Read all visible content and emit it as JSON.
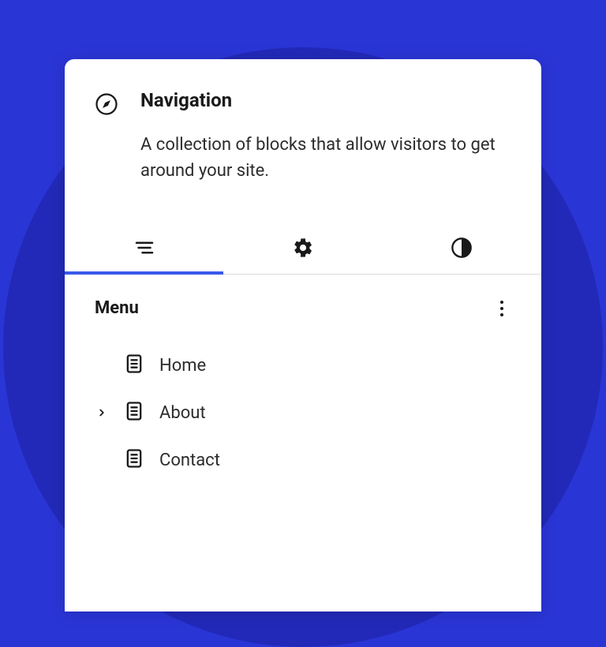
{
  "header": {
    "title": "Navigation",
    "description": "A collection of blocks that allow visitors to get around your site."
  },
  "tabs": {
    "active_index": 0
  },
  "menu": {
    "title": "Menu",
    "items": [
      {
        "label": "Home",
        "has_children": false
      },
      {
        "label": "About",
        "has_children": true
      },
      {
        "label": "Contact",
        "has_children": false
      }
    ]
  },
  "colors": {
    "accent": "#3858e9",
    "bg": "#2a35d6"
  }
}
